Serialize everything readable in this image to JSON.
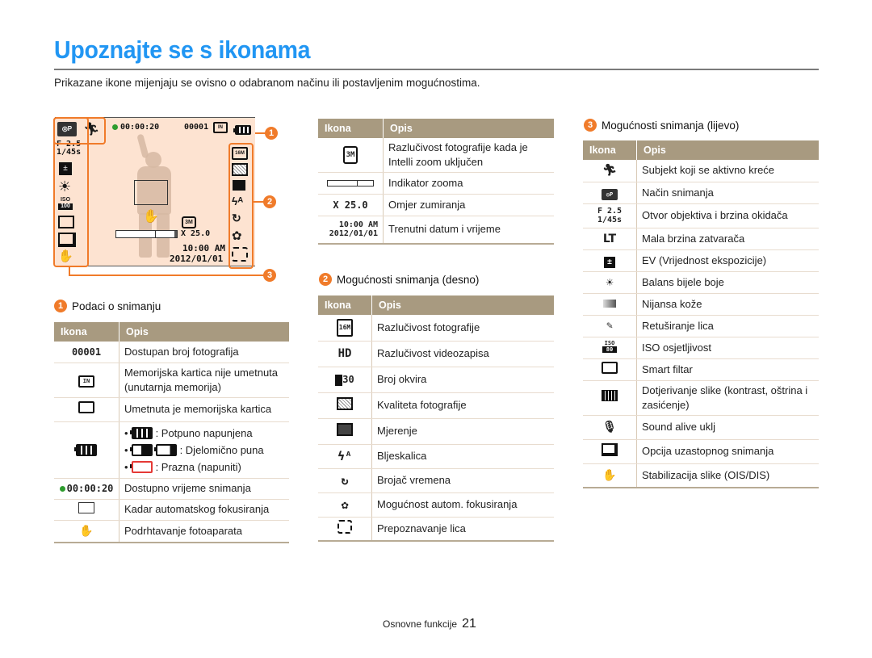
{
  "page": {
    "title": "Upoznajte se s ikonama",
    "intro": "Prikazane ikone mijenjaju se ovisno o odabranom načinu ili postavljenim mogućnostima.",
    "footer_section": "Osnovne funkcije",
    "page_number": "21"
  },
  "colors": {
    "title": "#2196f3",
    "accent_orange": "#f07b2a",
    "table_header": "#a89a80",
    "screen_bg": "#fde3d1",
    "record_dot": "#2e9c2e",
    "empty_battery": "#e53935"
  },
  "camera_screen": {
    "record_time": "00:00:20",
    "shot_count": "00001",
    "aperture": "F 2.5",
    "shutter": "1/45s",
    "zoom_ratio": "X 25.0",
    "time": "10:00 AM",
    "date": "2012/01/01",
    "resolution_badge": "3M",
    "callouts": [
      "1",
      "2",
      "3"
    ],
    "left_icons": [
      "camera-mode-icon",
      "active-subject-icon",
      "ev-icon",
      "white-balance-icon",
      "iso-icon",
      "smart-filter-icon",
      "burst-icon",
      "ois-off-icon"
    ],
    "right_icons": [
      "resolution-16m-icon",
      "quality-icon",
      "metering-icon",
      "flash-auto-icon",
      "timer-icon",
      "macro-icon",
      "face-detect-icon"
    ]
  },
  "section1": {
    "number": "1",
    "title": "Podaci o snimanju",
    "headers": [
      "Ikona",
      "Opis"
    ],
    "rows": [
      {
        "icon": "00001",
        "desc": "Dostupan broj fotografija"
      },
      {
        "icon": "internal-memory-icon",
        "desc": "Memorijska kartica nije umetnuta (unutarnja memorija)"
      },
      {
        "icon": "memory-card-icon",
        "desc": "Umetnuta je memorijska kartica"
      },
      {
        "icon": "battery-icon",
        "bullets": [
          {
            "icon": "battery-full-icon",
            "text": ": Potpuno napunjena"
          },
          {
            "icon": "battery-partial-icon",
            "text": ": Djelomično puna"
          },
          {
            "icon": "battery-empty-icon",
            "text": ": Prazna (napuniti)"
          }
        ]
      },
      {
        "icon": "00:00:20",
        "desc": "Dostupno vrijeme snimanja"
      },
      {
        "icon": "af-frame-icon",
        "desc": "Kadar automatskog fokusiranja"
      },
      {
        "icon": "camera-shake-icon",
        "desc": "Podrhtavanje fotoaparata"
      }
    ]
  },
  "table_top": {
    "headers": [
      "Ikona",
      "Opis"
    ],
    "rows": [
      {
        "icon": "3M",
        "desc": "Razlučivost fotografije kada je Intelli zoom uključen"
      },
      {
        "icon": "zoom-bar-icon",
        "desc": "Indikator zooma"
      },
      {
        "icon": "X 25.0",
        "desc": "Omjer zumiranja"
      },
      {
        "icon": "10:00 AM 2012/01/01",
        "icon_l1": "10:00 AM",
        "icon_l2": "2012/01/01",
        "desc": "Trenutni datum i vrijeme"
      }
    ]
  },
  "section2": {
    "number": "2",
    "title": "Mogućnosti snimanja (desno)",
    "headers": [
      "Ikona",
      "Opis"
    ],
    "rows": [
      {
        "icon": "16M",
        "desc": "Razlučivost fotografije"
      },
      {
        "icon": "HD",
        "desc": "Razlučivost videozapisa"
      },
      {
        "icon": "30",
        "desc": "Broj okvira"
      },
      {
        "icon": "quality-icon",
        "desc": "Kvaliteta fotografije"
      },
      {
        "icon": "metering-icon",
        "desc": "Mjerenje"
      },
      {
        "icon": "flash-auto-icon",
        "desc": "Bljeskalica"
      },
      {
        "icon": "timer-icon",
        "desc": "Brojač vremena"
      },
      {
        "icon": "macro-icon",
        "desc": "Mogućnost autom. fokusiranja"
      },
      {
        "icon": "face-detect-icon",
        "desc": "Prepoznavanje lica"
      }
    ]
  },
  "section3": {
    "number": "3",
    "title": "Mogućnosti snimanja (lijevo)",
    "headers": [
      "Ikona",
      "Opis"
    ],
    "rows": [
      {
        "icon": "active-subject-icon",
        "desc": "Subjekt koji se aktivno kreće"
      },
      {
        "icon": "camera-mode-icon",
        "desc": "Način snimanja"
      },
      {
        "icon": "F 2.5 1/45s",
        "icon_l1": "F 2.5",
        "icon_l2": "1/45s",
        "desc": "Otvor objektiva i brzina okidača"
      },
      {
        "icon": "LT",
        "desc": "Mala brzina zatvarača"
      },
      {
        "icon": "ev-icon",
        "desc": "EV (Vrijednost ekspozicije)"
      },
      {
        "icon": "white-balance-icon",
        "desc": "Balans bijele boje"
      },
      {
        "icon": "skin-tone-icon",
        "desc": "Nijansa kože"
      },
      {
        "icon": "face-retouch-icon",
        "desc": "Retuširanje lica"
      },
      {
        "icon": "iso-icon",
        "desc": "ISO osjetljivost"
      },
      {
        "icon": "smart-filter-icon",
        "desc": "Smart filtar"
      },
      {
        "icon": "image-adjust-icon",
        "desc": "Dotjerivanje slike (kontrast, oštrina i zasićenje)"
      },
      {
        "icon": "sound-alive-icon",
        "desc": "Sound alive uklj"
      },
      {
        "icon": "burst-icon",
        "desc": "Opcija uzastopnog snimanja"
      },
      {
        "icon": "ois-off-icon",
        "desc": "Stabilizacija slike (OIS/DIS)"
      }
    ]
  }
}
